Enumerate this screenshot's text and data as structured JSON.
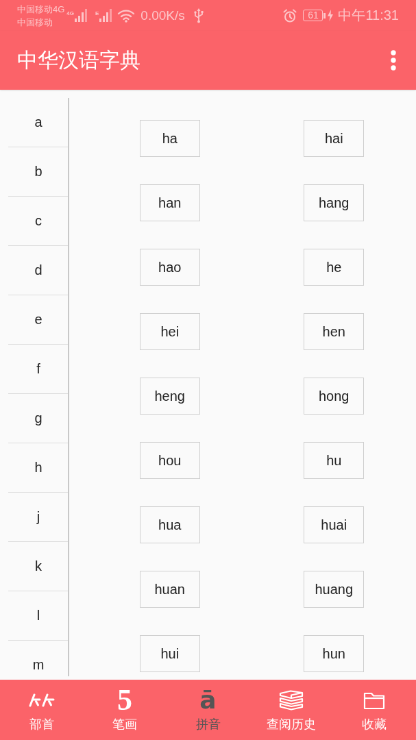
{
  "status_bar": {
    "carrier_top": "中国移动4G",
    "network_top": "4G",
    "carrier_bottom": "中国移动",
    "network_bottom": "E",
    "net_speed": "0.00K/s",
    "battery": "61",
    "time": "中午11:31"
  },
  "app_bar": {
    "title": "中华汉语字典"
  },
  "letters": [
    "a",
    "b",
    "c",
    "d",
    "e",
    "f",
    "g",
    "h",
    "j",
    "k",
    "l",
    "m"
  ],
  "syllables": [
    "ha",
    "hai",
    "han",
    "hang",
    "hao",
    "he",
    "hei",
    "hen",
    "heng",
    "hong",
    "hou",
    "hu",
    "hua",
    "huai",
    "huan",
    "huang",
    "hui",
    "hun"
  ],
  "bottom_nav": [
    {
      "kind": "strokes",
      "label": "部首",
      "selected": false
    },
    {
      "kind": "numeral",
      "glyph": "5",
      "label": "笔画",
      "selected": false
    },
    {
      "kind": "letter",
      "glyph": "ā",
      "label": "拼音",
      "selected": true
    },
    {
      "kind": "books",
      "label": "查阅历史",
      "selected": false
    },
    {
      "kind": "folder",
      "label": "收藏",
      "selected": false
    }
  ]
}
